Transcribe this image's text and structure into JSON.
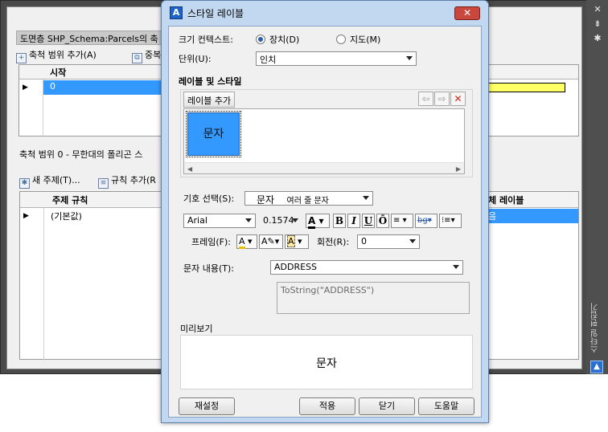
{
  "background": {
    "header_text": "도면층 SHP_Schema:Parcels의 축",
    "toolbar1": {
      "add_range": "축척 범위 추가(A)",
      "dup": "중복"
    },
    "grid1": {
      "column_header": "시작",
      "row_value": "0"
    },
    "range_label": "축척 범위 0 - 무한대의 폴리곤 스",
    "toolbar2": {
      "new_subject": "새 주제(T)...",
      "add_rule": "규칙 추가(R"
    },
    "grid2": {
      "column_header": "주제 규칙",
      "row_value": "(기본값)"
    },
    "right_table2": {
      "header": "체 레이블",
      "row_value": "음"
    },
    "side_strip": {
      "label": "스타일 편집기",
      "pin_icon": "pin-icon",
      "close_icon": "close-icon",
      "settings_icon": "settings-icon"
    }
  },
  "dialog": {
    "title": "스타일 레이블",
    "logo": "A",
    "close_symbol": "✕",
    "size_context": {
      "label": "크기 컨텍스트:",
      "option_device": "장치(D)",
      "option_map": "지도(M)",
      "selected": "device"
    },
    "units": {
      "label": "단위(U):",
      "value": "인치"
    },
    "labels_and_styles": {
      "section_title": "레이블 및 스타일",
      "add_label": "레이블 추가",
      "move_left_symbol": "⇦",
      "move_right_symbol": "⇨",
      "delete_symbol": "✕",
      "tiles": [
        {
          "text": "문자",
          "selected": true
        }
      ]
    },
    "symbol_select": {
      "label": "기호 선택(S):",
      "preview": "문자",
      "value": "여러 줄 문자"
    },
    "font": {
      "family": "Arial",
      "size": "0.1574",
      "color_letter": "A",
      "bold": "B",
      "italic": "I",
      "underline": "U",
      "overline": "Ō",
      "strike": "bg"
    },
    "frame": {
      "label": "프레임(F):",
      "btn1": "A",
      "btn2": "A",
      "btn3": "A"
    },
    "rotation": {
      "label": "회전(R):",
      "value": "0"
    },
    "text_content": {
      "label": "문자 내용(T):",
      "value": "ADDRESS",
      "expression": "ToString(\"ADDRESS\")"
    },
    "preview": {
      "label": "미리보기",
      "text": "문자"
    },
    "buttons": {
      "reset": "재설정",
      "apply": "적용",
      "close": "닫기",
      "help": "도움말"
    }
  }
}
